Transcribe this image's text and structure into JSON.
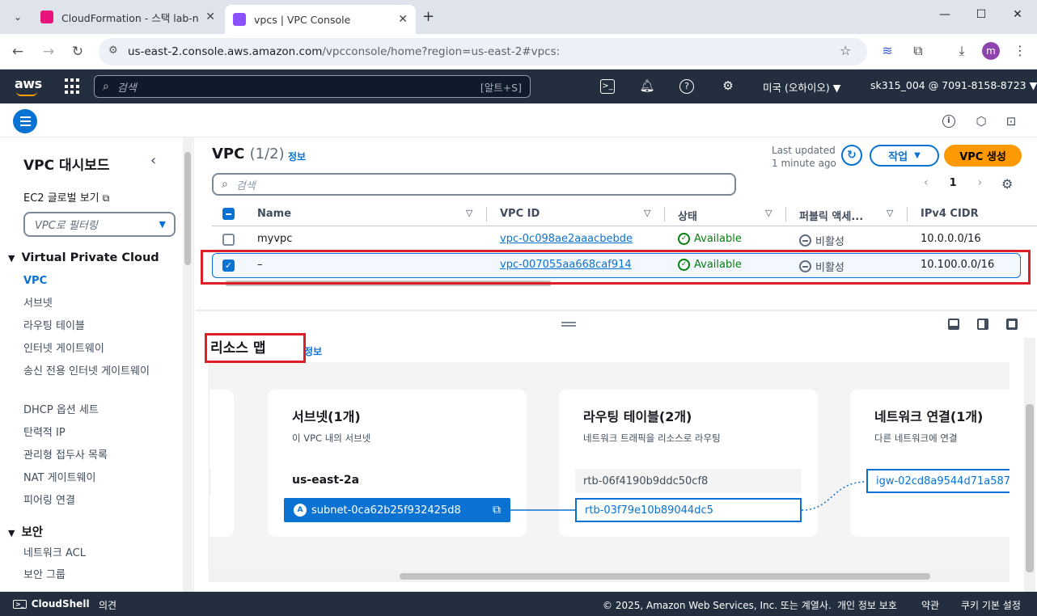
{
  "browser": {
    "tabs": [
      {
        "title": "CloudFormation - 스택 lab-net",
        "active": false
      },
      {
        "title": "vpcs | VPC Console",
        "active": true
      }
    ],
    "url_host": "us-east-2.console.aws.amazon.com",
    "url_path": "/vpcconsole/home?region=us-east-2#vpcs:",
    "profile_initial": "m"
  },
  "aws_nav": {
    "logo": "aws",
    "search_placeholder": "검색",
    "search_shortcut": "[알트+S]",
    "region": "미국 (오하이오) ▼",
    "account": "sk315_004 @ 7091-8158-8723 ▼"
  },
  "sidebar": {
    "title": "VPC 대시보드",
    "ec2_global": "EC2 글로벌 보기",
    "filter_placeholder": "VPC로 필터링",
    "section_vpc": "Virtual Private Cloud",
    "items": [
      "VPC",
      "서브넷",
      "라우팅 테이블",
      "인터넷 게이트웨이",
      "송신 전용 인터넷 게이트웨이",
      "DHCP 옵션 세트",
      "탄력적 IP",
      "관리형 접두사 목록",
      "NAT 게이트웨이",
      "피어링 연결"
    ],
    "section_security": "보안",
    "security_items": [
      "네트워크 ACL",
      "보안 그룹"
    ]
  },
  "vpc_table": {
    "title": "VPC",
    "count": "(1/2)",
    "info": "정보",
    "last_updated_1": "Last updated",
    "last_updated_2": "1 minute ago",
    "actions_label": "작업",
    "create_label": "VPC 생성",
    "search_placeholder": "검색",
    "page": "1",
    "columns": [
      "Name",
      "VPC ID",
      "상태",
      "퍼블릭 액세...",
      "IPv4 CIDR"
    ],
    "rows": [
      {
        "name": "myvpc",
        "vpc_id": "vpc-0c098ae2aaacbebde",
        "state": "Available",
        "public": "비활성",
        "cidr": "10.0.0.0/16",
        "selected": false
      },
      {
        "name": "–",
        "vpc_id": "vpc-007055aa668caf914",
        "state": "Available",
        "public": "비활성",
        "cidr": "10.100.0.0/16",
        "selected": true
      }
    ]
  },
  "resource_map": {
    "title": "리소스 맵",
    "info": "정보",
    "subnets": {
      "title": "서브넷(1개)",
      "subtitle": "이 VPC 내의 서브넷",
      "az": "us-east-2a",
      "subnet": "subnet-0ca62b25f932425d8",
      "badge": "A"
    },
    "route_tables": {
      "title": "라우팅 테이블(2개)",
      "subtitle": "네트워크 트래픽을 리소스로 라우팅",
      "items": [
        "rtb-06f4190b9ddc50cf8",
        "rtb-03f79e10b89044dc5"
      ]
    },
    "network": {
      "title": "네트워크 연결(1개)",
      "subtitle": "다른 네트워크에 연결",
      "igw": "igw-02cd8a9544d71a587"
    }
  },
  "footer": {
    "cloudshell": "CloudShell",
    "feedback": "의견",
    "copyright": "© 2025, Amazon Web Services, Inc. 또는 계열사.",
    "privacy": "개인 정보 보호",
    "terms": "약관",
    "cookies": "쿠키 기본 설정"
  },
  "colors": {
    "accent": "#0972d3",
    "brand": "#ff9900",
    "nav_bg": "#232f3e",
    "success": "#037f0c",
    "highlight": "#dd1e24"
  }
}
